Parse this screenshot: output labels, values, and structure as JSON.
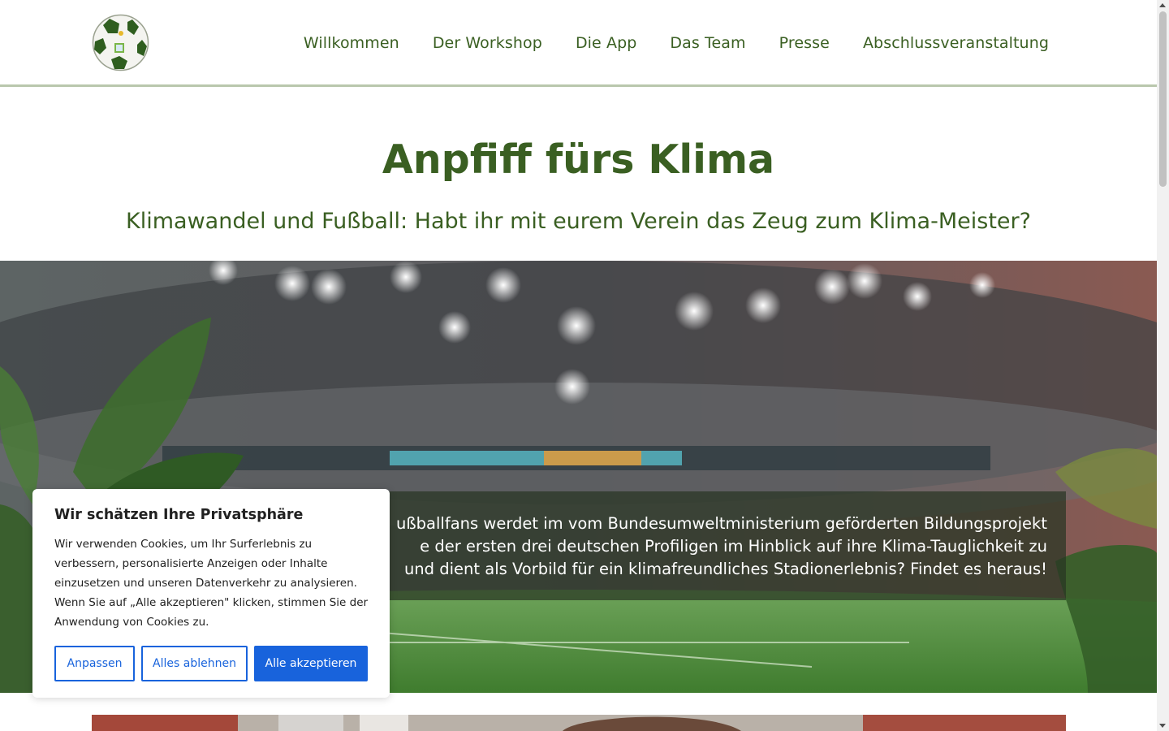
{
  "header": {
    "logo_alt": "soccer-ball-logo",
    "nav": [
      "Willkommen",
      "Der Workshop",
      "Die App",
      "Das Team",
      "Presse",
      "Abschlussveranstaltung"
    ]
  },
  "main": {
    "title": "Anpfiff fürs Klima",
    "subtitle": "Klimawandel und Fußball: Habt ihr mit eurem Verein das Zeug zum Klima-Meister?",
    "hero_text_lines": [
      "ußballfans werdet im vom Bundesumweltministerium geförderten Bildungsprojekt",
      "e der ersten drei deutschen Profiligen im Hinblick auf ihre Klima-Tauglichkeit zu",
      "und dient als Vorbild für ein klimafreundliches Stadionerlebnis? Findet es heraus!"
    ]
  },
  "cookie": {
    "title": "Wir schätzen Ihre Privatsphäre",
    "text": "Wir verwenden Cookies, um Ihr Surferlebnis zu verbessern, personalisierte Anzeigen oder Inhalte einzusetzen und unseren Datenverkehr zu analysieren. Wenn Sie auf „Alle akzeptieren\" klicken, stimmen Sie der Anwendung von Cookies zu.",
    "customize_label": "Anpassen",
    "reject_label": "Alles ablehnen",
    "accept_label": "Alle akzeptieren"
  },
  "colors": {
    "brand_green": "#3a5f22",
    "cookie_blue": "#1863dc"
  }
}
